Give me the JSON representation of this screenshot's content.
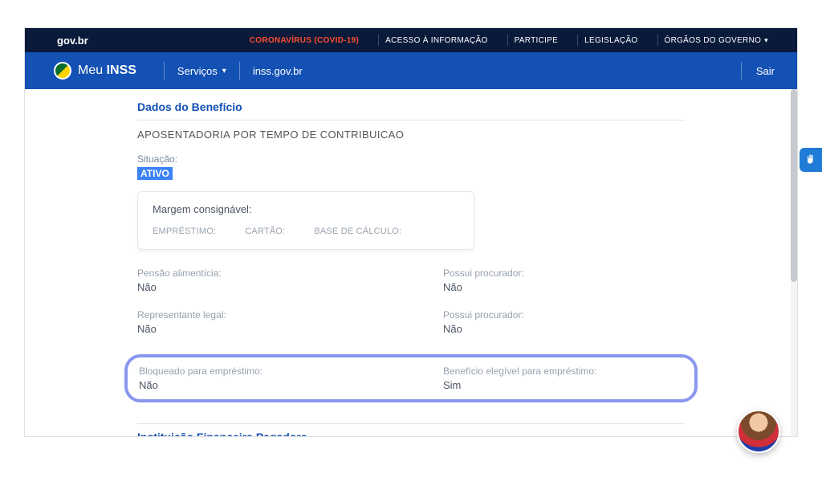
{
  "topbar": {
    "gov": "gov.br",
    "covid": "CORONAVÍRUS (COVID-19)",
    "links": [
      "ACESSO À INFORMAÇÃO",
      "PARTICIPE",
      "LEGISLAÇÃO",
      "ÓRGÃOS DO GOVERNO"
    ]
  },
  "nav": {
    "brand_plain": "Meu ",
    "brand_bold": "INSS",
    "services": "Serviços",
    "url": "inss.gov.br",
    "exit": "Sair"
  },
  "section": {
    "head": "Dados do Benefício",
    "title": "APOSENTADORIA POR TEMPO DE CONTRIBUICAO",
    "situacao_label": "Situação:",
    "situacao_value": "ATIVO"
  },
  "card": {
    "head": "Margem consignável:",
    "cols": [
      "EMPRÉSTIMO:",
      "CARTÃO:",
      "BASE DE CÁLCULO:"
    ]
  },
  "fields": {
    "pensao_label": "Pensão alimentícia:",
    "pensao_value": "Não",
    "proc1_label": "Possui procurador:",
    "proc1_value": "Não",
    "rep_label": "Representante legal:",
    "rep_value": "Não",
    "proc2_label": "Possui procurador:",
    "proc2_value": "Não",
    "bloq_label": "Bloqueado para empréstimo:",
    "bloq_value": "Não",
    "eleg_label": "Benefício elegível para empréstimo:",
    "eleg_value": "Sim"
  },
  "inst_head": "Instituição Financeira Pagadora"
}
